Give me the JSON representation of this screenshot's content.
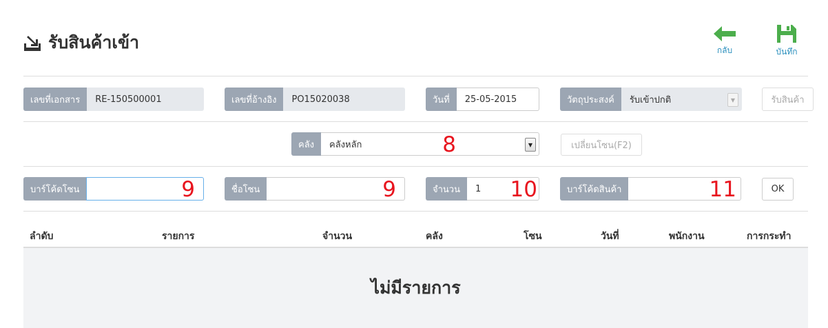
{
  "page": {
    "title": "รับสินค้าเข้า",
    "title_icon": "download-to-tray-icon"
  },
  "toolbar": {
    "back_label": "กลับ",
    "back_icon": "arrow-left-icon",
    "back_color": "#4cae4c",
    "save_label": "บันทึก",
    "save_icon": "floppy-disk-icon",
    "save_color": "#4cae4c"
  },
  "header_fields": {
    "doc_no": {
      "label": "เลขที่เอกสาร",
      "value": "RE-150500001"
    },
    "ref_no": {
      "label": "เลขที่อ้างอิง",
      "value": "PO15020038"
    },
    "date": {
      "label": "วันที่",
      "value": "25-05-2015"
    },
    "purpose": {
      "label": "วัตถุประสงค์",
      "value": "รับเข้าปกติ"
    },
    "receive_button": "รับสินค้า"
  },
  "warehouse": {
    "label": "คลัง",
    "value": "คลังหลัก",
    "annotation": "8",
    "change_zone_button": "เปลี่ยนโซน(F2)"
  },
  "entry": {
    "zone_barcode": {
      "label": "บาร์โค้ดโซน",
      "value": "",
      "annotation": "9"
    },
    "zone_name": {
      "label": "ชื่อโซน",
      "value": "",
      "annotation": "9"
    },
    "quantity": {
      "label": "จำนวน",
      "value": "1",
      "annotation": "10"
    },
    "product_barcode": {
      "label": "บาร์โค้ดสินค้า",
      "value": "",
      "annotation": "11"
    },
    "ok_button": "OK"
  },
  "table": {
    "columns": [
      "ลำดับ",
      "รายการ",
      "จำนวน",
      "คลัง",
      "โซน",
      "วันที่",
      "พนักงาน",
      "การกระทำ"
    ],
    "empty_text": "ไม่มีรายการ"
  },
  "colors": {
    "annotation": "#e8141e",
    "addon": "#9ca6b3",
    "accent_green": "#4cae4c",
    "link_blue": "#2a8fbd"
  }
}
